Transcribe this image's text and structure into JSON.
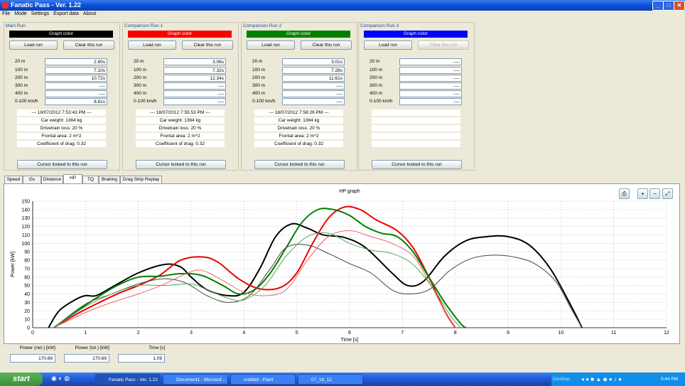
{
  "window": {
    "title": "Fanatic Pass - Ver. 1.22"
  },
  "menu": [
    "File",
    "Mode",
    "Settings",
    "Export data",
    "About"
  ],
  "metric_labels": [
    "20 m",
    "100 m",
    "200 m",
    "300 m",
    "400 m",
    "0-100 km/h"
  ],
  "runs": [
    {
      "title": "Main Run",
      "graph_color_label": "Graph color",
      "color": "#000000",
      "load": "Load run",
      "clear": "Clear this run",
      "metrics": [
        "2.80s",
        "7.10s",
        "10.72s",
        "----",
        "----",
        "8.81s"
      ],
      "timestamp": "--- 18/07/2012 7:53:43 PM ---",
      "weight": "Car weight: 1364 kg",
      "drivetrain": "Drivetrain loss: 20 %",
      "frontal": "Frontal area: 2 m^2",
      "drag": "Coefficient of drag: 0.32",
      "cursor": "Cursor locked to this run"
    },
    {
      "title": "Comparison Run 1",
      "graph_color_label": "Graph color",
      "color": "#ff0000",
      "load": "Load run",
      "clear": "Clear this run",
      "metrics": [
        "3.06s",
        "7.32s",
        "12.34s",
        "----",
        "----",
        "----"
      ],
      "timestamp": "--- 18/07/2012 7:55:53 PM ---",
      "weight": "Car weight: 1364 kg",
      "drivetrain": "Drivetrain loss: 20 %",
      "frontal": "Frontal area: 2 m^2",
      "drag": "Coefficient of drag: 0.32",
      "cursor": "Cursor locked to this run"
    },
    {
      "title": "Comparison Run 2",
      "graph_color_label": "Graph color",
      "color": "#008000",
      "load": "Load run",
      "clear": "Clear this run",
      "metrics": [
        "3.01s",
        "7.28s",
        "11.61s",
        "----",
        "----",
        "----"
      ],
      "timestamp": "--- 18/07/2012 7:58:26 PM ---",
      "weight": "Car weight: 1364 kg",
      "drivetrain": "Drivetrain loss: 20 %",
      "frontal": "Frontal area: 2 m^2",
      "drag": "Coefficient of drag: 0.32",
      "cursor": "Cursor locked to this run"
    },
    {
      "title": "Comparison Run 3",
      "graph_color_label": "Graph color",
      "color": "#0000ff",
      "load": "Load run",
      "clear": "Clear this run",
      "metrics": [
        "----",
        "----",
        "----",
        "----",
        "----",
        "----"
      ],
      "timestamp": "",
      "weight": "",
      "drivetrain": "",
      "frontal": "",
      "drag": "",
      "cursor": "Cursor locked to this run"
    }
  ],
  "tabs": [
    "Speed",
    "Gs",
    "Distance",
    "HP",
    "TQ",
    "Braking",
    "Drag Strip Replay"
  ],
  "active_tab": "HP",
  "readouts": {
    "power_net_label": "Power (net.) [kW]",
    "power_net": "170.69",
    "power_tot_label": "Power (tot.) [kW]",
    "power_tot": "170.69",
    "time_label": "Time [s]",
    "time": "1.09"
  },
  "taskbar": {
    "start": "start",
    "items": [
      "Fanatic Pass - Ver. 1.22",
      "Document1 - Microsof...",
      "untitled - Paint",
      "07_18_12"
    ],
    "desktop": "Desktop",
    "clock": "9:44 PM"
  },
  "chart_data": {
    "type": "line",
    "title": "HP graph",
    "xlabel": "Time [s]",
    "ylabel": "Power [kW]",
    "xlim": [
      0,
      12
    ],
    "ylim": [
      0,
      150
    ],
    "xticks": [
      0,
      1,
      2,
      3,
      4,
      5,
      6,
      7,
      8,
      9,
      10,
      11,
      12
    ],
    "yticks": [
      0,
      10,
      20,
      30,
      40,
      50,
      60,
      70,
      80,
      90,
      100,
      110,
      120,
      130,
      140,
      150
    ],
    "grid": true,
    "series": [
      {
        "color": "#000000",
        "width": 2,
        "x": [
          0.3,
          0.5,
          0.8,
          1.0,
          1.2,
          1.5,
          2.0,
          2.5,
          2.8,
          3.0,
          3.3,
          3.7,
          4.0,
          4.3,
          4.6,
          4.9,
          5.2,
          5.5,
          5.9,
          6.3,
          6.8,
          7.1,
          7.4,
          7.8,
          8.2,
          8.6,
          9.0,
          9.4,
          9.8,
          10.2,
          10.4
        ],
        "y": [
          0,
          20,
          33,
          38,
          38,
          48,
          65,
          75,
          72,
          60,
          45,
          38,
          42,
          70,
          108,
          123,
          118,
          110,
          107,
          95,
          65,
          50,
          55,
          85,
          103,
          108,
          108,
          98,
          70,
          25,
          0
        ]
      },
      {
        "color": "#ee0000",
        "width": 2,
        "x": [
          0.4,
          0.8,
          1.2,
          1.6,
          2.0,
          2.4,
          2.8,
          3.2,
          3.5,
          3.9,
          4.3,
          4.7,
          5.0,
          5.3,
          5.6,
          5.9,
          6.2,
          6.5,
          6.9,
          7.2,
          7.5,
          7.8,
          8.0
        ],
        "y": [
          0,
          15,
          28,
          40,
          50,
          62,
          80,
          84,
          78,
          58,
          46,
          48,
          65,
          100,
          130,
          143,
          140,
          128,
          115,
          95,
          60,
          20,
          0
        ]
      },
      {
        "color": "#008000",
        "width": 2,
        "x": [
          0.4,
          0.8,
          1.2,
          1.6,
          2.0,
          2.4,
          2.8,
          3.2,
          3.6,
          3.9,
          4.2,
          4.5,
          4.8,
          5.1,
          5.4,
          5.7,
          6.0,
          6.3,
          6.6,
          6.9,
          7.2,
          7.5,
          7.8,
          8.1,
          8.2
        ],
        "y": [
          0,
          18,
          35,
          50,
          60,
          61,
          64,
          62,
          50,
          40,
          45,
          65,
          95,
          125,
          140,
          140,
          133,
          120,
          112,
          108,
          90,
          60,
          30,
          5,
          0
        ]
      },
      {
        "color": "#444444",
        "width": 1,
        "x": [
          0.4,
          1.0,
          1.5,
          2.0,
          2.5,
          2.9,
          3.3,
          3.7,
          4.1,
          4.5,
          4.8,
          5.2,
          5.6,
          6.0,
          6.4,
          6.8,
          7.1,
          7.5,
          7.9,
          8.3,
          8.7,
          9.1,
          9.5,
          9.9,
          10.2,
          10.4
        ],
        "y": [
          0,
          28,
          40,
          52,
          58,
          53,
          38,
          30,
          38,
          70,
          95,
          98,
          88,
          76,
          65,
          45,
          40,
          45,
          68,
          82,
          86,
          84,
          76,
          55,
          22,
          0
        ]
      },
      {
        "color": "#ee6666",
        "width": 1,
        "x": [
          0.4,
          1.0,
          1.5,
          2.0,
          2.5,
          2.9,
          3.2,
          3.6,
          4.0,
          4.4,
          4.8,
          5.2,
          5.6,
          6.0,
          6.4,
          6.8,
          7.2,
          7.5,
          7.8,
          8.0
        ],
        "y": [
          0,
          18,
          30,
          40,
          52,
          64,
          68,
          56,
          42,
          38,
          45,
          80,
          108,
          115,
          108,
          100,
          85,
          55,
          20,
          0
        ]
      },
      {
        "color": "#55aa55",
        "width": 1,
        "x": [
          0.4,
          1.0,
          1.5,
          2.0,
          2.5,
          3.0,
          3.3,
          3.7,
          4.0,
          4.4,
          4.8,
          5.2,
          5.6,
          6.0,
          6.4,
          6.8,
          7.2,
          7.6,
          7.9,
          8.1
        ],
        "y": [
          0,
          25,
          40,
          50,
          50,
          52,
          45,
          35,
          33,
          50,
          85,
          108,
          112,
          100,
          92,
          88,
          75,
          45,
          15,
          0
        ]
      }
    ]
  }
}
